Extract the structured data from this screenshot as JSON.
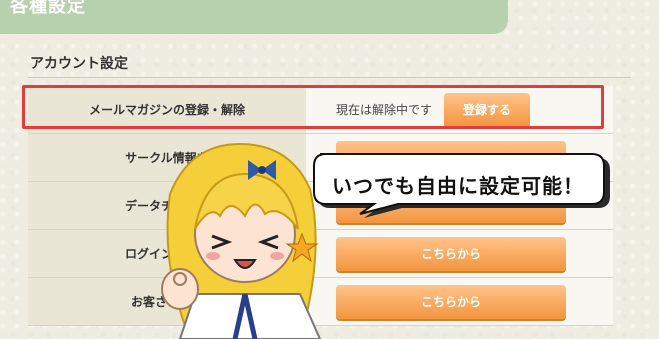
{
  "header": {
    "title": "各種設定"
  },
  "section": {
    "title": "アカウント設定"
  },
  "rows": [
    {
      "label": "メールマガジンの登録・解除",
      "status": "現在は解除中です",
      "button": "登録する"
    },
    {
      "label": "サークル情報を",
      "button": ""
    },
    {
      "label": "データチェック",
      "button": ""
    },
    {
      "label": "ログイン用パス",
      "button": "こちらから"
    },
    {
      "label": "お客さまノー",
      "button": "こちらから"
    }
  ],
  "bubble": {
    "text": "いつでも自由に設定可能！"
  },
  "colors": {
    "header": "#b7d0ad",
    "highlight": "#e53b3b",
    "button": "#f3953f"
  }
}
